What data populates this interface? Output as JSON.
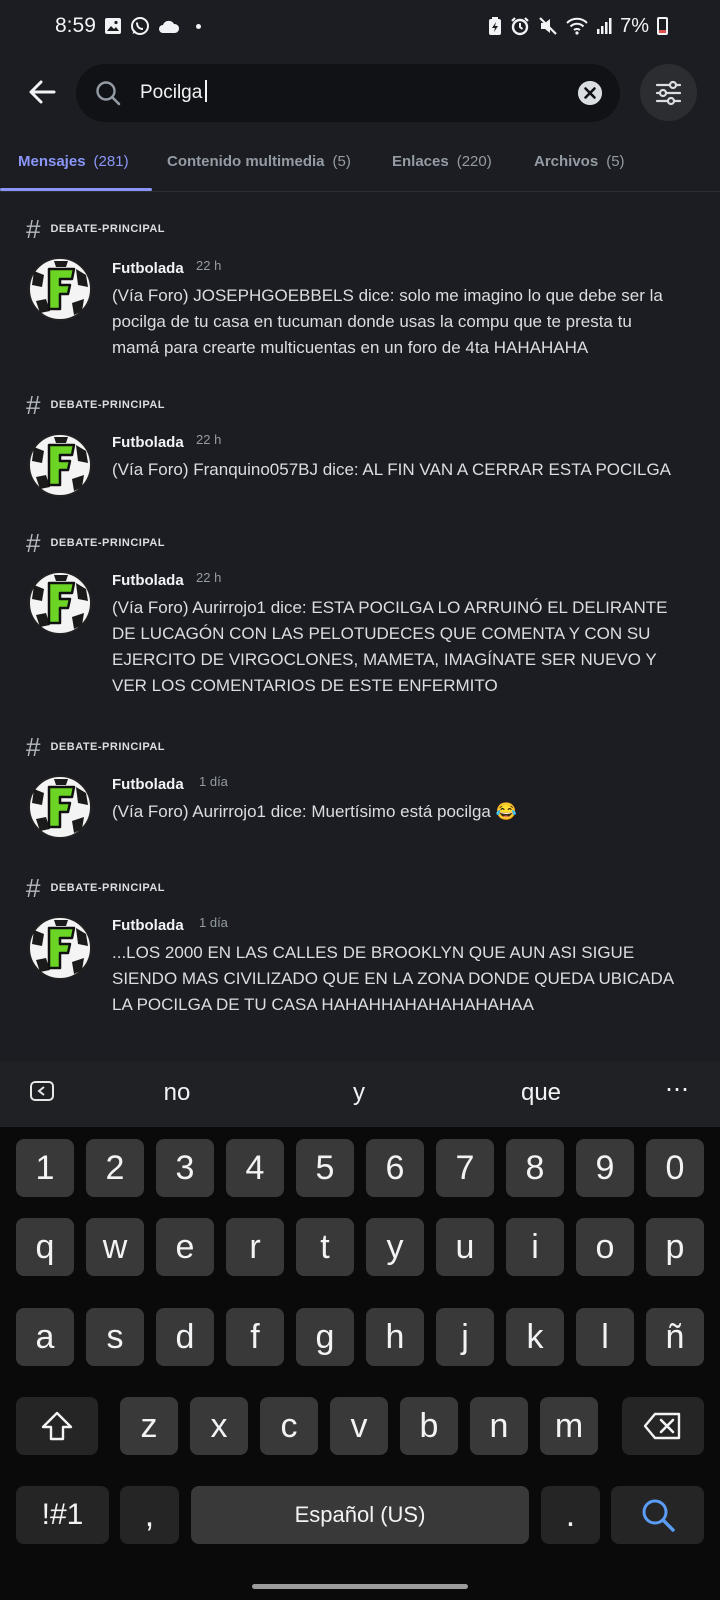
{
  "status_bar": {
    "time": "8:59",
    "battery": "7%",
    "left_icons": [
      "gallery-icon",
      "whatsapp-icon",
      "cloud-icon"
    ],
    "right_icons": [
      "battery-saver-icon",
      "alarm-icon",
      "mute-icon",
      "wifi-icon",
      "signal-icon"
    ]
  },
  "search": {
    "query": "Pocilga",
    "icons": [
      "back-arrow-icon",
      "search-icon",
      "clear-icon",
      "filter-sliders-icon"
    ]
  },
  "tabs": [
    {
      "label": "Mensajes",
      "count": "(281)",
      "active": true
    },
    {
      "label": "Contenido multimedia",
      "count": "(5)",
      "active": false
    },
    {
      "label": "Enlaces",
      "count": "(220)",
      "active": false
    },
    {
      "label": "Archivos",
      "count": "(5)",
      "active": false
    }
  ],
  "results": [
    {
      "channel": "DEBATE-PRINCIPAL",
      "author": "Futbolada",
      "time": "22 h",
      "text": "(Vía Foro) JOSEPHGOEBBELS dice: solo me imagino lo que debe ser la pocilga de tu casa en tucuman donde usas la compu que te presta tu mamá para crearte multicuentas en un foro de 4ta HAHAHAHA"
    },
    {
      "channel": "DEBATE-PRINCIPAL",
      "author": "Futbolada",
      "time": "22 h",
      "text": "(Vía Foro) Franquino057BJ dice: AL FIN VAN A CERRAR ESTA POCILGA"
    },
    {
      "channel": "DEBATE-PRINCIPAL",
      "author": "Futbolada",
      "time": "22 h",
      "text": "(Vía Foro) Aurirrojo1 dice: ESTA POCILGA LO ARRUINÓ EL DELIRANTE DE LUCAGÓN CON LAS PELOTUDECES QUE COMENTA Y CON SU EJERCITO DE VIRGOCLONES, MAMETA, IMAGÍNATE SER NUEVO Y VER LOS COMENTARIOS DE ESTE ENFERMITO"
    },
    {
      "channel": "DEBATE-PRINCIPAL",
      "author": "Futbolada",
      "time": "1 día",
      "text": "(Vía Foro) Aurirrojo1 dice: Muertísimo está pocilga 😂"
    },
    {
      "channel": "DEBATE-PRINCIPAL",
      "author": "Futbolada",
      "time": "1 día",
      "text": "...LOS 2000 EN LAS CALLES DE BROOKLYN QUE AUN ASI SIGUE SIENDO MAS CIVILIZADO QUE EN LA ZONA DONDE QUEDA UBICADA LA POCILGA DE TU CASA HAHAHHAHAHAHAHAHAA"
    }
  ],
  "suggestions": [
    "no",
    "y",
    "que"
  ],
  "keyboard": {
    "numbers": [
      "1",
      "2",
      "3",
      "4",
      "5",
      "6",
      "7",
      "8",
      "9",
      "0"
    ],
    "row1": [
      "q",
      "w",
      "e",
      "r",
      "t",
      "y",
      "u",
      "i",
      "o",
      "p"
    ],
    "row2": [
      "a",
      "s",
      "d",
      "f",
      "g",
      "h",
      "j",
      "k",
      "l",
      "ñ"
    ],
    "row3": [
      "z",
      "x",
      "c",
      "v",
      "b",
      "n",
      "m"
    ],
    "symbols_label": "!#1",
    "comma": ",",
    "space_label": "Español (US)",
    "period": "."
  },
  "colors": {
    "background": "#1c1d22",
    "accent": "#8a96f7",
    "logo_green": "#6bd425"
  }
}
